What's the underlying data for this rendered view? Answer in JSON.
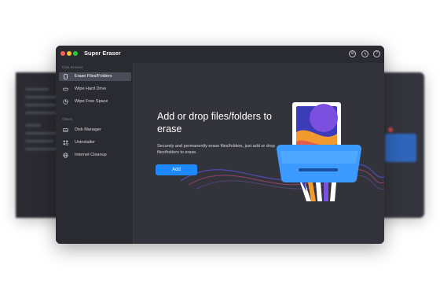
{
  "window": {
    "title": "Super Eraser",
    "toolbar_icons": [
      "gear-icon",
      "clock-icon",
      "help-icon"
    ]
  },
  "sidebar": {
    "sections": [
      {
        "label": "Data Erasure",
        "items": [
          {
            "label": "Erase Files/Folders",
            "icon": "file-icon",
            "active": true
          },
          {
            "label": "Wipe Hard Drive",
            "icon": "drive-icon",
            "active": false
          },
          {
            "label": "Wipe Free Space",
            "icon": "pie-icon",
            "active": false
          }
        ]
      },
      {
        "label": "Others",
        "items": [
          {
            "label": "Disk Manager",
            "icon": "disk-icon",
            "active": false
          },
          {
            "label": "Uninstaller",
            "icon": "uninstall-icon",
            "active": false
          },
          {
            "label": "Internet Cleanup",
            "icon": "globe-icon",
            "active": false
          }
        ]
      }
    ]
  },
  "main": {
    "headline": "Add or drop files/folders to erase",
    "description": "Securely and permanently erase files/folders, just add or drop files/folders to erase.",
    "add_button": "Add"
  },
  "colors": {
    "accent": "#1e88ff",
    "window_bg": "#2f3037",
    "sidebar_bg": "#2a2b31"
  }
}
